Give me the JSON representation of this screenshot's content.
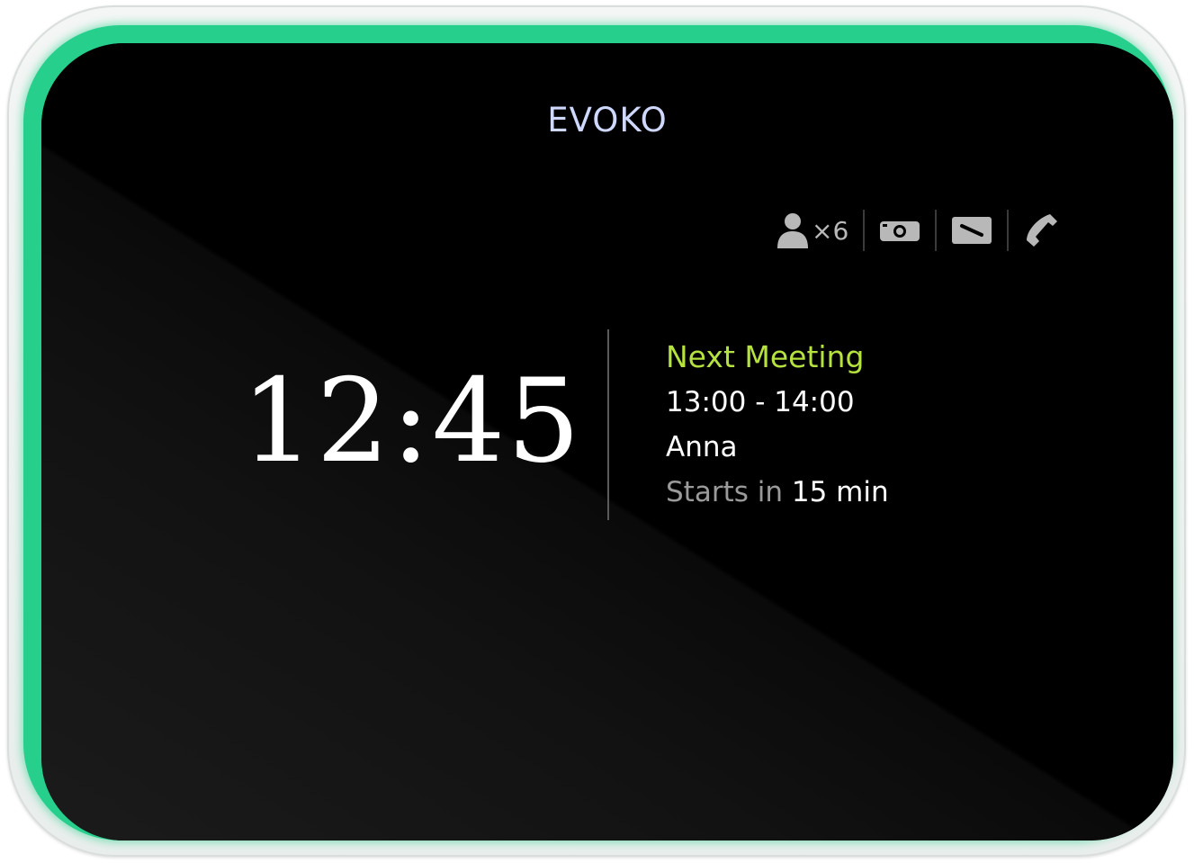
{
  "brand": {
    "logo_text": "EVOKO"
  },
  "amenities": {
    "capacity_icon": "person-icon",
    "capacity_text": "×6",
    "items": [
      "projector-icon",
      "whiteboard-icon",
      "phone-icon"
    ]
  },
  "clock": {
    "time": "12:45"
  },
  "next_meeting": {
    "heading": "Next Meeting",
    "time_range": "13:00 - 14:00",
    "organizer": "Anna",
    "starts_prefix": "Starts in",
    "starts_value": "15 min"
  },
  "colors": {
    "led_ring": "#27cf8d",
    "screen": "#000000",
    "heading_accent": "#b6e23f",
    "logo": "#cfd8ff"
  }
}
